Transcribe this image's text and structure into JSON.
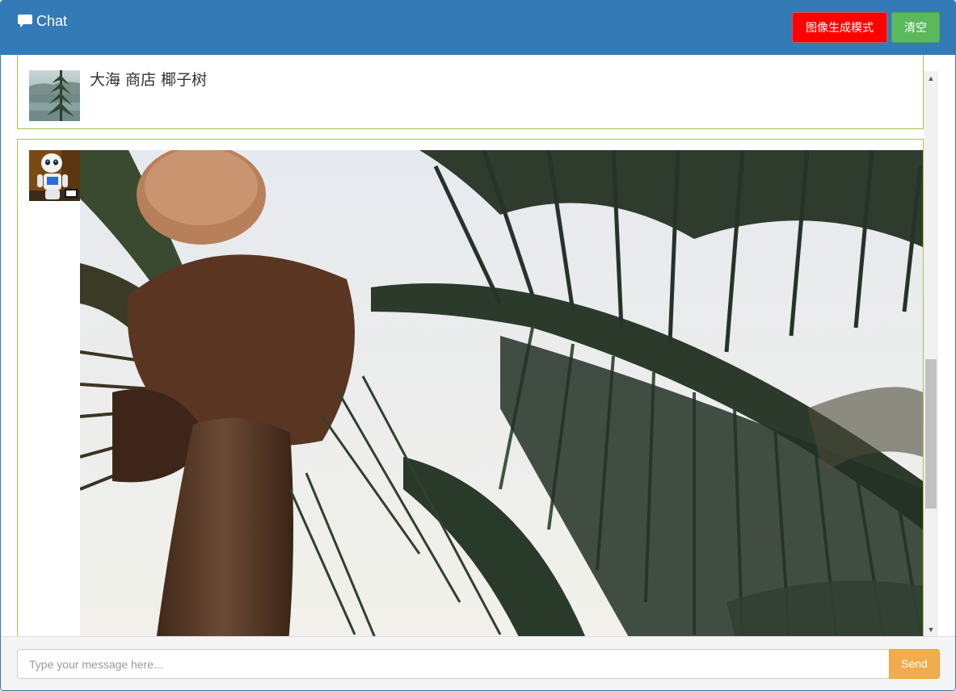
{
  "header": {
    "title": "Chat",
    "title_icon": "speech-bubble-icon",
    "mode_button_label": "图像生成模式",
    "clear_button_label": "清空",
    "background_color": "#337ab7",
    "mode_button_color": "#ff0000",
    "clear_button_color": "#5cb85c"
  },
  "messages": [
    {
      "role": "user",
      "avatar_icon": "landscape-thumbnail",
      "text": "大海 商店 椰子树"
    },
    {
      "role": "bot",
      "avatar_icon": "robot-icon",
      "image": "generated-palm-tree-image"
    }
  ],
  "footer": {
    "input_placeholder": "Type your message here...",
    "input_value": "",
    "send_button_label": "Send",
    "send_button_color": "#f0ad4e"
  },
  "message_border_color": "#a6c449"
}
